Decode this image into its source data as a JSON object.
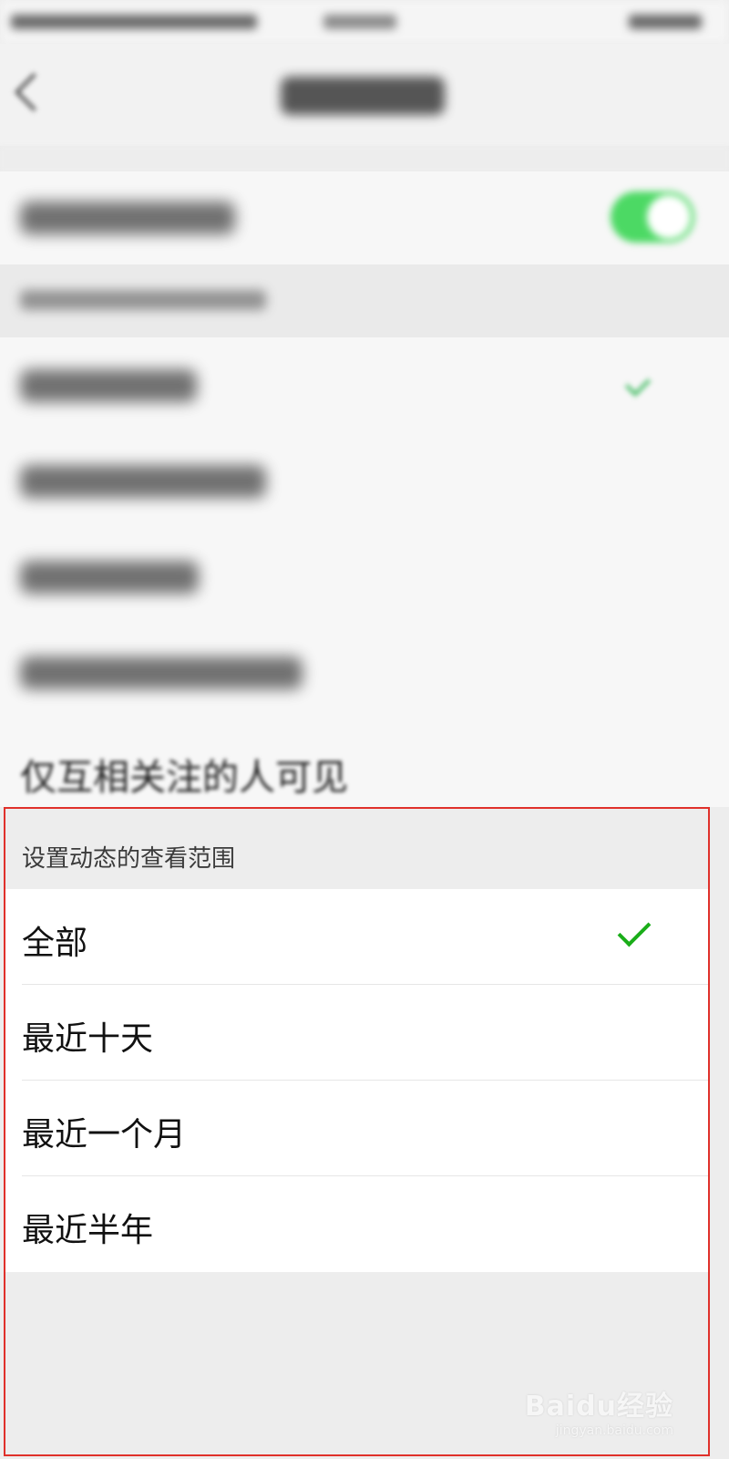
{
  "background_blurred": {
    "partial_row_label": "仅互相关注的人可见"
  },
  "panel": {
    "header": "设置动态的查看范围",
    "options": [
      {
        "label": "全部",
        "selected": true
      },
      {
        "label": "最近十天",
        "selected": false
      },
      {
        "label": "最近一个月",
        "selected": false
      },
      {
        "label": "最近半年",
        "selected": false
      }
    ],
    "border_color": "#e0312b",
    "check_color": "#1aad19"
  },
  "watermark": {
    "brand": "Baidu经验",
    "url": "jingyan.baidu.com"
  }
}
